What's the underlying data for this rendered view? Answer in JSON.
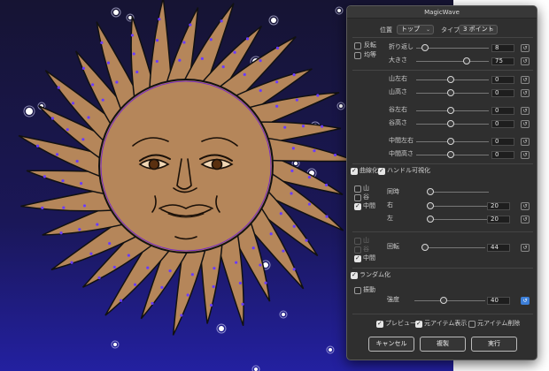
{
  "dialog": {
    "title": "MagicWave",
    "position_label": "位置",
    "position_value": "トップ",
    "type_label": "タイプ",
    "type_value": "3 ポイント",
    "cb_reverse": "反転",
    "cb_equal": "均等",
    "wrap_label": "折り返し",
    "wrap_value": "8",
    "size_label": "大きさ",
    "size_value": "75",
    "mountain_lr_label": "山左右",
    "mountain_lr_value": "0",
    "mountain_h_label": "山高さ",
    "mountain_h_value": "0",
    "valley_lr_label": "谷左右",
    "valley_lr_value": "0",
    "valley_h_label": "谷高さ",
    "valley_h_value": "0",
    "middle_lr_label": "中間左右",
    "middle_lr_value": "0",
    "middle_h_label": "中間高さ",
    "middle_h_value": "0",
    "curve_label": "曲線化",
    "handle_visible_label": "ハンドル可視化",
    "cb_mountain": "山",
    "cb_valley": "谷",
    "cb_middle": "中間",
    "sync_label": "同時",
    "right_label": "右",
    "right_value": "20",
    "left_label": "左",
    "left_value": "20",
    "cb_mountain2": "山",
    "cb_valley2": "谷",
    "cb_middle2": "中間",
    "rotate_label": "回転",
    "rotate_value": "44",
    "randomize_label": "ランダム化",
    "vibrate_label": "振動",
    "strength_label": "強度",
    "strength_value": "40",
    "preview_label": "プレビュー",
    "show_original_label": "元アイテム表示",
    "delete_original_label": "元アイテム削除",
    "cancel_button": "キャンセル",
    "duplicate_button": "複製",
    "run_button": "実行",
    "icon_label": "↺"
  },
  "colors": {
    "sky_top": "#161433",
    "sky_bottom": "#1e1c8e",
    "sun_fill": "#b5865a",
    "dot": "#6a3cff",
    "accent": "#3d7fd8"
  }
}
